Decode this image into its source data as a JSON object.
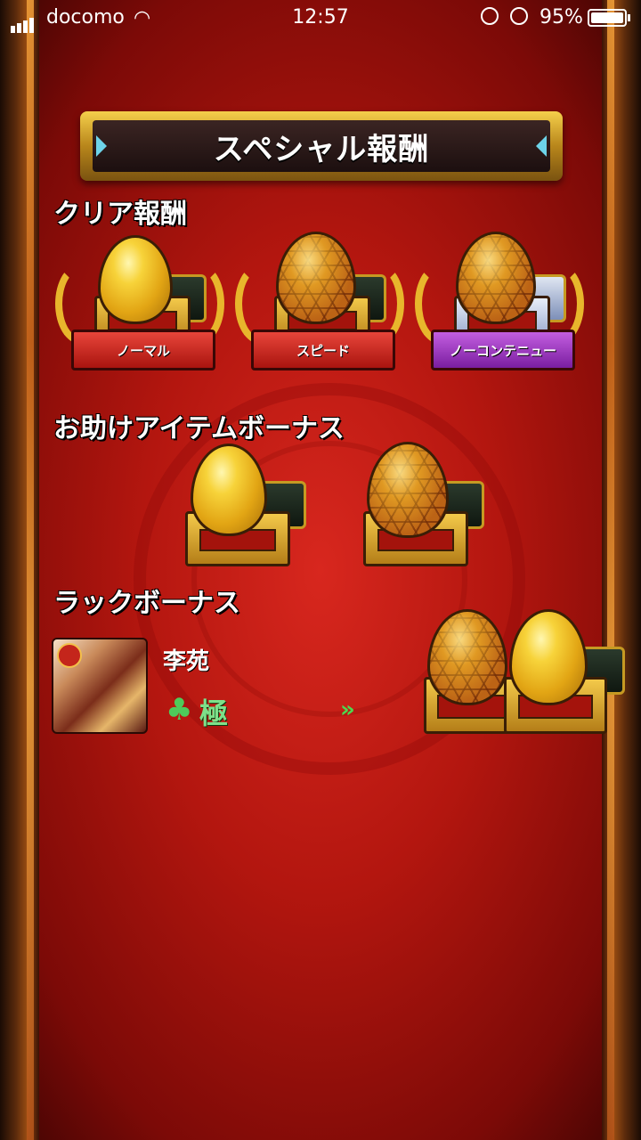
{
  "status_bar": {
    "carrier": "docomo",
    "time": "12:57",
    "battery": "95%"
  },
  "title": "スペシャル報酬",
  "sections": {
    "clear_rewards": {
      "heading": "クリア報酬",
      "items": [
        {
          "label": "ノーマル",
          "egg": "gold"
        },
        {
          "label": "スピード",
          "egg": "hex"
        },
        {
          "label": "ノーコンテニュー",
          "egg": "hex"
        }
      ]
    },
    "item_bonus": {
      "heading": "お助けアイテムボーナス"
    },
    "luck_bonus": {
      "heading": "ラックボーナス",
      "character_name": "李苑",
      "luck_rank": "極",
      "arrows": "»"
    }
  },
  "colors": {
    "background": "#b3160f",
    "gold": "#e2a514",
    "ribbon_red": "#c62a20",
    "ribbon_purple": "#9b3cc5",
    "luck_green": "#7ee08a"
  }
}
